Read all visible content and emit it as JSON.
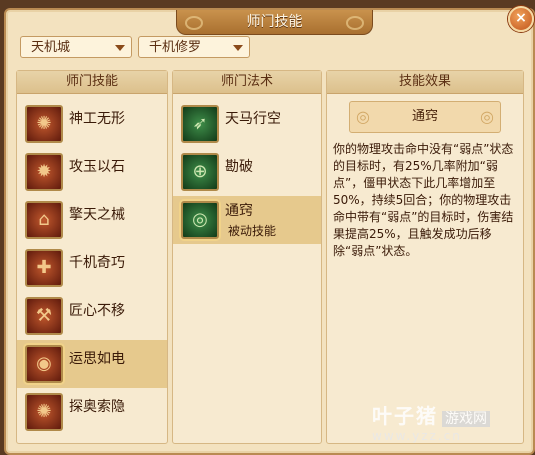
{
  "window": {
    "title": "师门技能",
    "close_icon": "×"
  },
  "dropdowns": [
    {
      "value": "天机城"
    },
    {
      "value": "千机修罗"
    }
  ],
  "skills_panel": {
    "header": "师门技能",
    "items": [
      {
        "name": "神工无形",
        "icon": "swirl-icon",
        "glyph": "✺"
      },
      {
        "name": "攻玉以石",
        "icon": "gear-icon",
        "glyph": "✹"
      },
      {
        "name": "擎天之械",
        "icon": "pillar-icon",
        "glyph": "⌂"
      },
      {
        "name": "千机奇巧",
        "icon": "cross-tools-icon",
        "glyph": "✚"
      },
      {
        "name": "匠心不移",
        "icon": "hammer-icon",
        "glyph": "⚒"
      },
      {
        "name": "运思如电",
        "icon": "eye-swirl-icon",
        "glyph": "◉"
      },
      {
        "name": "探奥索隐",
        "icon": "vortex-icon",
        "glyph": "✺"
      }
    ],
    "selected_index": 5
  },
  "methods_panel": {
    "header": "师门法术",
    "items": [
      {
        "name": "天马行空",
        "sub": "",
        "icon": "wing-icon",
        "glyph": "➶"
      },
      {
        "name": "勘破",
        "sub": "",
        "icon": "crosshair-icon",
        "glyph": "⊕"
      },
      {
        "name": "通窍",
        "sub": "被动技能",
        "icon": "eye-icon",
        "glyph": "◎"
      }
    ],
    "selected_index": 2
  },
  "effect_panel": {
    "header": "技能效果",
    "name": "通窍",
    "text": "你的物理攻击命中没有“弱点”状态的目标时，有25%几率附加“弱点”，僵甲状态下此几率增加至50%，持续5回合；你的物理攻击命中带有“弱点”的目标时，伤害结果提高25%，且触发成功后移除“弱点”状态。"
  },
  "watermark": {
    "main": "叶子猪",
    "box": "游戏网",
    "url": "www.yzz.cn"
  },
  "colors": {
    "accent": "#b98a52",
    "selected": "#e6c98d",
    "text": "#3a1a08"
  }
}
